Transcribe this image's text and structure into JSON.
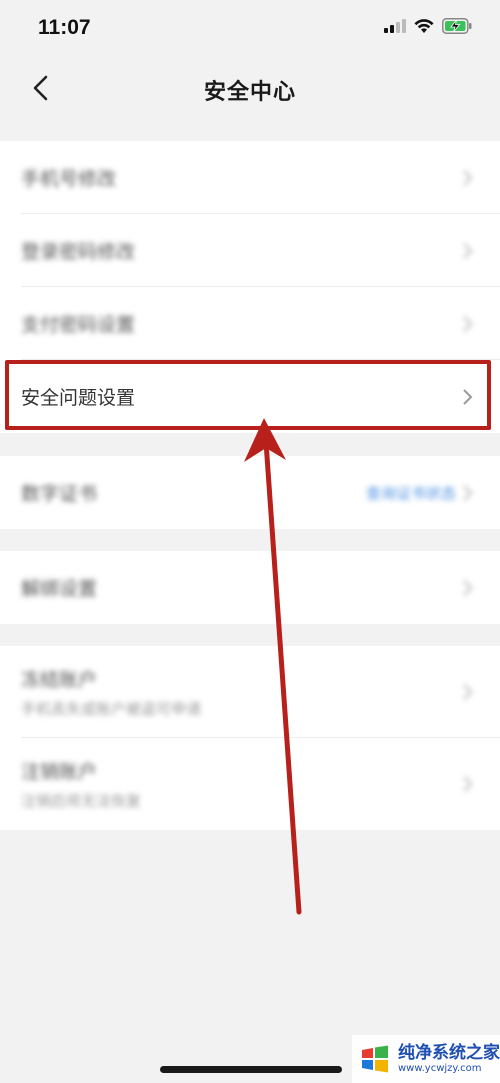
{
  "status_bar": {
    "time": "11:07"
  },
  "nav": {
    "title": "安全中心"
  },
  "group1": {
    "items": [
      {
        "label": "手机号修改"
      },
      {
        "label": "登录密码修改"
      },
      {
        "label": "支付密码设置"
      },
      {
        "label": "安全问题设置"
      }
    ]
  },
  "group2": {
    "items": [
      {
        "label": "数字证书",
        "value": "查询证书状态"
      }
    ]
  },
  "group3": {
    "items": [
      {
        "label": "解绑设置"
      }
    ]
  },
  "group4": {
    "items": [
      {
        "label": "冻结账户",
        "sub": "手机丢失或账户被盗可申请"
      },
      {
        "label": "注销账户",
        "sub": "注销后将无法恢复"
      }
    ]
  },
  "watermark": {
    "name": "纯净系统之家",
    "url": "www.ycwjzy.com"
  },
  "colors": {
    "highlight": "#b8201c",
    "link": "#4a90e2",
    "background": "#f2f2f2"
  }
}
